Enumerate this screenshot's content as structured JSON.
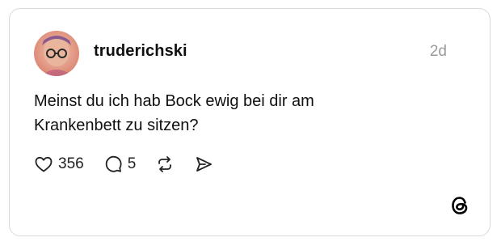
{
  "post": {
    "username": "truderichski",
    "timestamp": "2d",
    "text": "Meinst du ich hab Bock ewig bei dir am Krankenbett zu sitzen?",
    "likes": "356",
    "replies": "5"
  },
  "icons": {
    "like": "heart-icon",
    "reply": "comment-icon",
    "repost": "repost-icon",
    "share": "send-icon",
    "brand": "threads-logo-icon"
  }
}
